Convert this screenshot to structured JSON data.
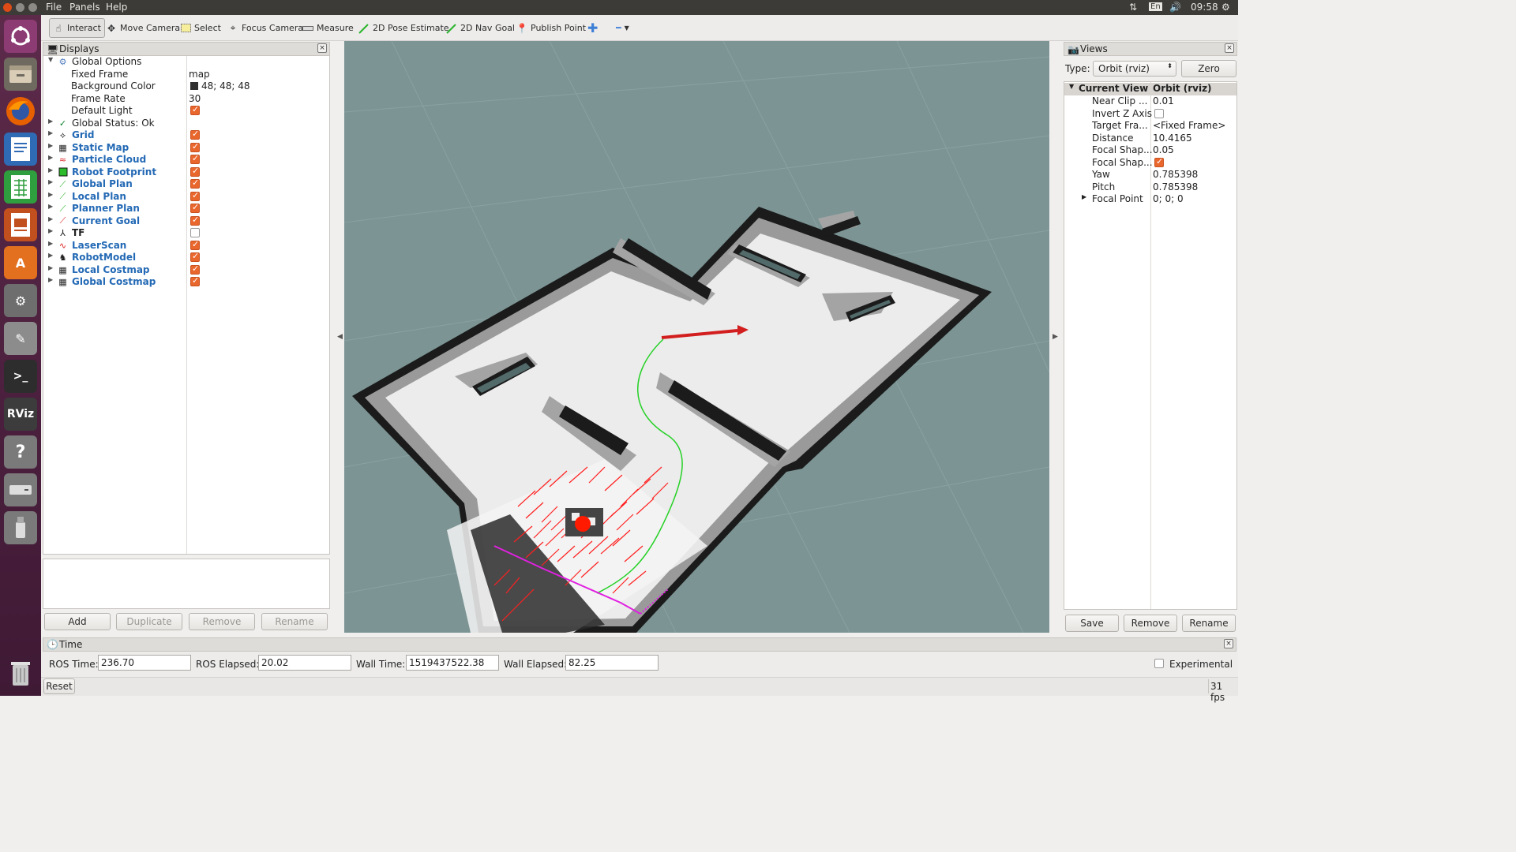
{
  "menubar": {
    "items": [
      "File",
      "Panels",
      "Help"
    ],
    "language": "En",
    "clock": "09:58"
  },
  "toolbar": {
    "tools": [
      {
        "label": "Interact",
        "icon": "hand-pointer-icon"
      },
      {
        "label": "Move Camera",
        "icon": "move-camera-icon"
      },
      {
        "label": "Select",
        "icon": "select-rect-icon"
      },
      {
        "label": "Focus Camera",
        "icon": "focus-camera-icon"
      },
      {
        "label": "Measure",
        "icon": "ruler-icon"
      },
      {
        "label": "2D Pose Estimate",
        "icon": "green-arrow-icon"
      },
      {
        "label": "2D Nav Goal",
        "icon": "green-arrow-icon"
      },
      {
        "label": "Publish Point",
        "icon": "map-pin-icon"
      }
    ]
  },
  "displays": {
    "title": "Displays",
    "global_options": {
      "label": "Global Options",
      "fixed_frame_label": "Fixed Frame",
      "fixed_frame": "map",
      "background_color_label": "Background Color",
      "background_color": "48; 48; 48",
      "frame_rate_label": "Frame Rate",
      "frame_rate": "30",
      "default_light_label": "Default Light"
    },
    "global_status": "Global Status: Ok",
    "items": [
      {
        "label": "Grid",
        "checked": true
      },
      {
        "label": "Static Map",
        "checked": true
      },
      {
        "label": "Particle Cloud",
        "checked": true
      },
      {
        "label": "Robot Footprint",
        "checked": true
      },
      {
        "label": "Global Plan",
        "checked": true
      },
      {
        "label": "Local Plan",
        "checked": true
      },
      {
        "label": "Planner Plan",
        "checked": true
      },
      {
        "label": "Current Goal",
        "checked": true
      },
      {
        "label": "TF",
        "checked": false
      },
      {
        "label": "LaserScan",
        "checked": true
      },
      {
        "label": "RobotModel",
        "checked": true
      },
      {
        "label": "Local Costmap",
        "checked": true
      },
      {
        "label": "Global Costmap",
        "checked": true
      }
    ],
    "buttons": {
      "add": "Add",
      "duplicate": "Duplicate",
      "remove": "Remove",
      "rename": "Rename"
    }
  },
  "views": {
    "title": "Views",
    "type_label": "Type:",
    "type_value": "Orbit (rviz)",
    "zero_label": "Zero",
    "header": {
      "name": "Current View",
      "value": "Orbit (rviz)"
    },
    "rows": [
      {
        "name": "Near Clip ...",
        "value": "0.01"
      },
      {
        "name": "Invert Z Axis",
        "value": ""
      },
      {
        "name": "Target Fra...",
        "value": "<Fixed Frame>"
      },
      {
        "name": "Distance",
        "value": "10.4165"
      },
      {
        "name": "Focal Shap...",
        "value": "0.05"
      },
      {
        "name": "Focal Shap...",
        "value": ""
      },
      {
        "name": "Yaw",
        "value": "0.785398"
      },
      {
        "name": "Pitch",
        "value": "0.785398"
      },
      {
        "name": "Focal Point",
        "value": "0; 0; 0"
      }
    ],
    "buttons": {
      "save": "Save",
      "remove": "Remove",
      "rename": "Rename"
    }
  },
  "time": {
    "title": "Time",
    "ros_time_label": "ROS Time:",
    "ros_time": "236.70",
    "ros_elapsed_label": "ROS Elapsed:",
    "ros_elapsed": "20.02",
    "wall_time_label": "Wall Time:",
    "wall_time": "1519437522.38",
    "wall_elapsed_label": "Wall Elapsed:",
    "wall_elapsed": "82.25",
    "experimental_label": "Experimental"
  },
  "status": {
    "reset": "Reset",
    "fps": "31 fps"
  },
  "colors": {
    "accent": "#e9662c",
    "view_background": "#7c9494",
    "item_blue": "#2369b5",
    "launcher": "#4a1f3d"
  }
}
